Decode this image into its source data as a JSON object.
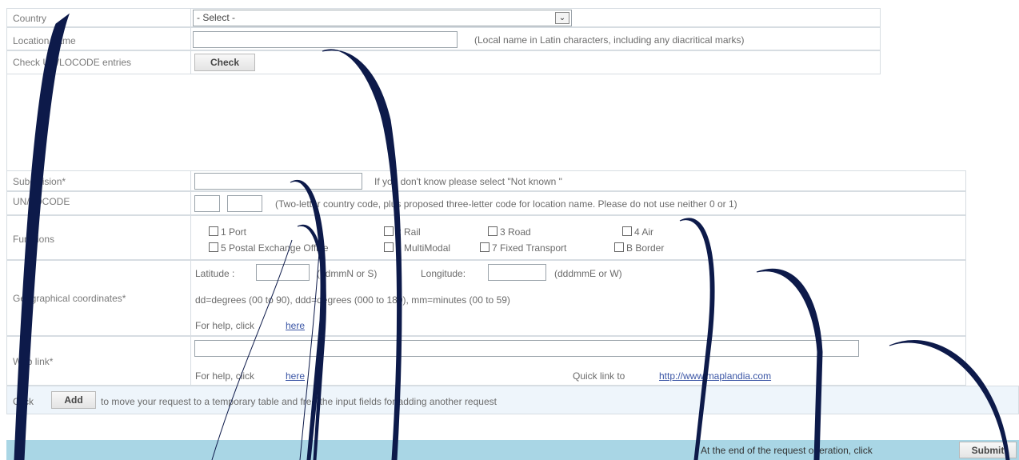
{
  "form": {
    "country": {
      "label": "Country",
      "value": "- Select -"
    },
    "location_name": {
      "label": "Location name",
      "value": "",
      "hint": "(Local name in Latin characters, including any diacritical marks)"
    },
    "check_entries": {
      "label": "Check UN/LOCODE entries",
      "button": "Check"
    },
    "subdivision": {
      "label": "Subdivision*",
      "value": "",
      "hint": "If you don't know please select \"Not known \""
    },
    "unlocode": {
      "label": "UN/LOCODE",
      "country_code": "",
      "location_code": "",
      "hint": "(Two-letter country code, plus proposed three-letter code for location name. Please do not use neither 0 or 1)"
    },
    "functions": {
      "label": "Functions",
      "items": [
        "1 Port",
        "2 Rail",
        "3 Road",
        "4 Air",
        "5 Postal Exchange Office",
        "6 MultiModal",
        "7 Fixed Transport",
        "B Border"
      ]
    },
    "geo": {
      "label": "Geographical coordinates*",
      "latitude_label": "Latitude :",
      "latitude_hint": "(ddmmN or S)",
      "longitude_label": "Longitude:",
      "longitude_hint": "(dddmmE or W)",
      "help_text": "dd=degrees (00 to 90), ddd=degrees (000 to 180), mm=minutes (00 to 59)",
      "help_prefix": "For help, click",
      "help_link": "here"
    },
    "web_link": {
      "label": "Web link*",
      "value": "",
      "help_prefix": "For help, click",
      "help_link": "here",
      "quick_prefix": "Quick link to",
      "quick_url": "http://www.maplandia.com"
    },
    "add_row": {
      "prefix": "Click",
      "button": "Add",
      "suffix": "to move your request to a temporary table and free the input fields for adding another request"
    },
    "footer": {
      "text": "At the end of the request operation, click",
      "button": "Submit"
    }
  },
  "colors": {
    "footer_bar": "#a9d6e5",
    "add_row_bg": "#eef5fb",
    "overlay_curve": "#0d1a4a"
  }
}
